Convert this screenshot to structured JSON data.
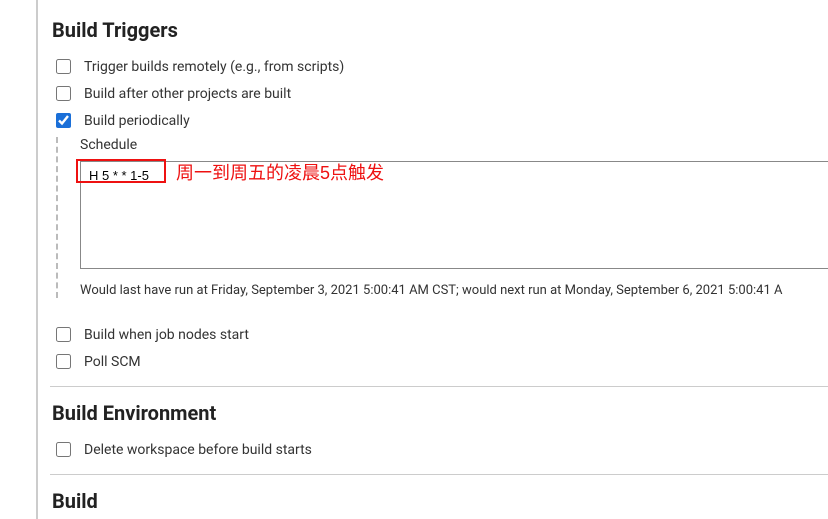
{
  "sections": {
    "build_triggers": {
      "title": "Build Triggers",
      "options": {
        "remote": {
          "label": "Trigger builds remotely (e.g., from scripts)",
          "checked": false
        },
        "after_projects": {
          "label": "Build after other projects are built",
          "checked": false
        },
        "periodically": {
          "label": "Build periodically",
          "checked": true,
          "schedule_label": "Schedule",
          "schedule_value": "H 5 * * 1-5",
          "validation": "Would last have run at Friday, September 3, 2021 5:00:41 AM CST; would next run at Monday, September 6, 2021 5:00:41 A"
        },
        "job_nodes": {
          "label": "Build when job nodes start",
          "checked": false
        },
        "poll_scm": {
          "label": "Poll SCM",
          "checked": false
        }
      }
    },
    "build_environment": {
      "title": "Build Environment",
      "options": {
        "delete_workspace": {
          "label": "Delete workspace before build starts",
          "checked": false
        }
      }
    },
    "build": {
      "title": "Build"
    }
  },
  "annotation": {
    "text": "周一到周五的凌晨5点触发"
  }
}
